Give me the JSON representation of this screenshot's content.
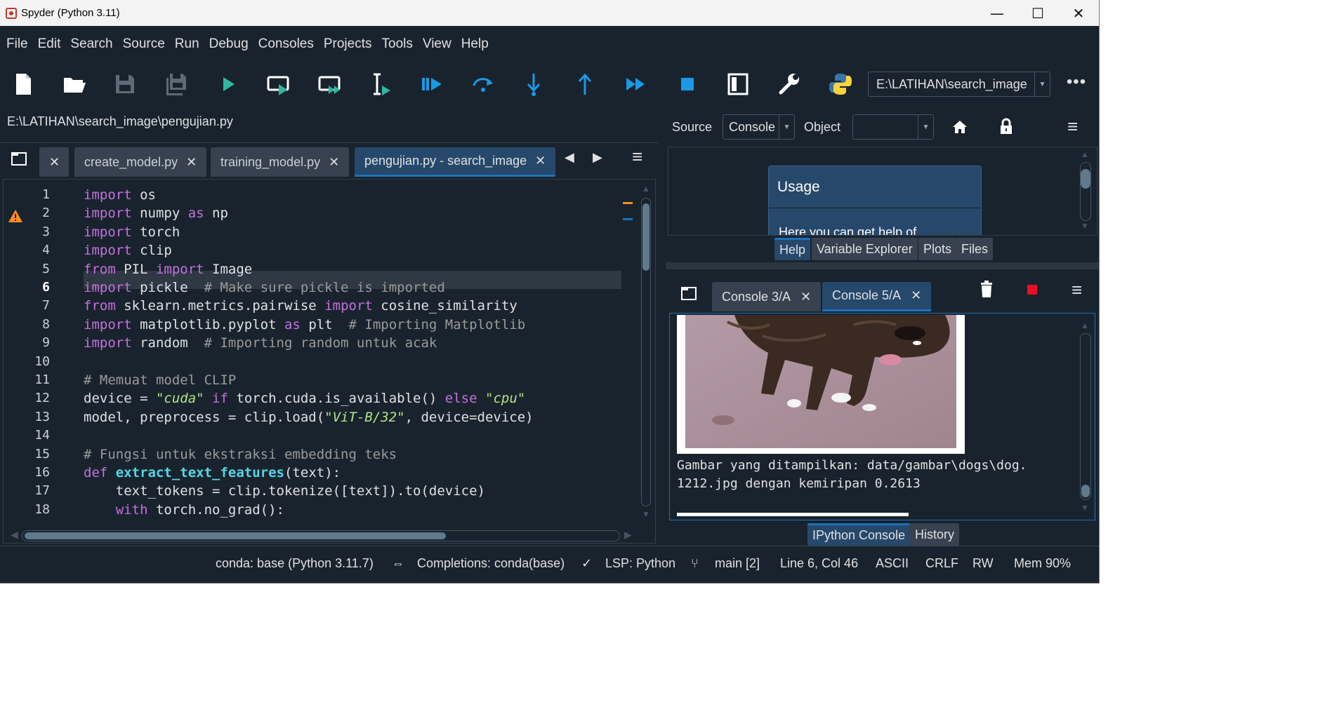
{
  "window": {
    "title": "Spyder (Python 3.11)",
    "minimize": "—",
    "maximize": "☐",
    "close": "✕"
  },
  "menu": [
    "File",
    "Edit",
    "Search",
    "Source",
    "Run",
    "Debug",
    "Consoles",
    "Projects",
    "Tools",
    "View",
    "Help"
  ],
  "toolbar": {
    "working_dir": "E:\\LATIHAN\\search_image",
    "more": "•••",
    "icons": [
      "new-file-icon",
      "open-folder-icon",
      "save-icon",
      "save-all-icon",
      "run-icon",
      "run-cell-icon",
      "run-cell-advance-icon",
      "run-selection-icon",
      "debug-icon",
      "step-over-icon",
      "step-into-icon",
      "step-return-icon",
      "continue-icon",
      "stop-icon",
      "maximize-pane-icon",
      "preferences-wrench-icon",
      "python-path-icon"
    ]
  },
  "editor": {
    "file_path": "E:\\LATIHAN\\search_image\\pengujian.py",
    "tabs": [
      {
        "label": "",
        "close": "✕"
      },
      {
        "label": "create_model.py",
        "close": "✕"
      },
      {
        "label": "training_model.py",
        "close": "✕"
      },
      {
        "label": "pengujian.py - search_image",
        "close": "✕"
      }
    ],
    "nav_prev": "◀",
    "nav_next": "▶",
    "menu": "≡",
    "current_line": 6,
    "warning_line": 2,
    "lines": [
      [
        {
          "t": "import",
          "c": "kw"
        },
        {
          "t": " os"
        }
      ],
      [
        {
          "t": "import",
          "c": "kw"
        },
        {
          "t": " numpy "
        },
        {
          "t": "as",
          "c": "kw"
        },
        {
          "t": " np"
        }
      ],
      [
        {
          "t": "import",
          "c": "kw"
        },
        {
          "t": " torch"
        }
      ],
      [
        {
          "t": "import",
          "c": "kw"
        },
        {
          "t": " clip"
        }
      ],
      [
        {
          "t": "from",
          "c": "kw"
        },
        {
          "t": " PIL "
        },
        {
          "t": "import",
          "c": "kw"
        },
        {
          "t": " Image"
        }
      ],
      [
        {
          "t": "import",
          "c": "kw"
        },
        {
          "t": " pickle  "
        },
        {
          "t": "# Make sure pickle is imported",
          "c": "cm"
        }
      ],
      [
        {
          "t": "from",
          "c": "kw"
        },
        {
          "t": " sklearn.metrics.pairwise "
        },
        {
          "t": "import",
          "c": "kw"
        },
        {
          "t": " cosine_similarity"
        }
      ],
      [
        {
          "t": "import",
          "c": "kw"
        },
        {
          "t": " matplotlib.pyplot "
        },
        {
          "t": "as",
          "c": "kw"
        },
        {
          "t": " plt  "
        },
        {
          "t": "# Importing Matplotlib",
          "c": "cm"
        }
      ],
      [
        {
          "t": "import",
          "c": "kw"
        },
        {
          "t": " random  "
        },
        {
          "t": "# Importing random untuk acak",
          "c": "cm"
        }
      ],
      [],
      [
        {
          "t": "# Memuat model CLIP",
          "c": "cm"
        }
      ],
      [
        {
          "t": "device = "
        },
        {
          "t": "\"cuda\"",
          "c": "st"
        },
        {
          "t": " "
        },
        {
          "t": "if",
          "c": "kw"
        },
        {
          "t": " torch.cuda.is_available() "
        },
        {
          "t": "else",
          "c": "kw"
        },
        {
          "t": " "
        },
        {
          "t": "\"cpu\"",
          "c": "st"
        }
      ],
      [
        {
          "t": "model, preprocess = clip.load("
        },
        {
          "t": "\"ViT-B/32\"",
          "c": "st"
        },
        {
          "t": ", device=device)"
        }
      ],
      [],
      [
        {
          "t": "# Fungsi untuk ekstraksi embedding teks",
          "c": "cm"
        }
      ],
      [
        {
          "t": "def",
          "c": "kw"
        },
        {
          "t": " "
        },
        {
          "t": "extract_text_features",
          "c": "fn"
        },
        {
          "t": "(text):"
        }
      ],
      [
        {
          "t": "    text_tokens = clip.tokenize([text]).to(device)"
        }
      ],
      [
        {
          "t": "    "
        },
        {
          "t": "with",
          "c": "kw"
        },
        {
          "t": " torch.no_grad():"
        }
      ]
    ]
  },
  "help": {
    "source_label": "Source",
    "source_value": "Console",
    "object_label": "Object",
    "object_value": "",
    "usage_title": "Usage",
    "usage_text": "Here you can get help of",
    "menu": "≡",
    "tabs": [
      "Help",
      "Variable Explorer",
      "Plots",
      "Files"
    ],
    "active_tab": "Help"
  },
  "console": {
    "tabs": [
      {
        "label": "Console 3/A",
        "close": "✕"
      },
      {
        "label": "Console 5/A",
        "close": "✕"
      }
    ],
    "active_tab": "Console 5/A",
    "output_lines": [
      "Gambar yang ditampilkan: data/gambar\\dogs\\dog.",
      "1212.jpg dengan kemiripan 0.2613"
    ],
    "menu": "≡",
    "bottom_tabs": [
      "IPython Console",
      "History"
    ],
    "active_bottom_tab": "IPython Console",
    "stop_color": "#e81123"
  },
  "status": {
    "conda": "conda: base (Python 3.11.7)",
    "completions": "Completions: conda(base)",
    "lsp": "LSP: Python",
    "git": "main [2]",
    "position": "Line 6, Col 46",
    "encoding": "ASCII",
    "eol": "CRLF",
    "permissions": "RW",
    "memory": "Mem 90%"
  },
  "colors": {
    "background": "#19232d",
    "accent": "#1a72bb",
    "keyword": "#c670e0",
    "comment": "#9a9a9a",
    "string": "#b0e686",
    "function": "#57d6e4",
    "warning": "#ff8c1a"
  }
}
